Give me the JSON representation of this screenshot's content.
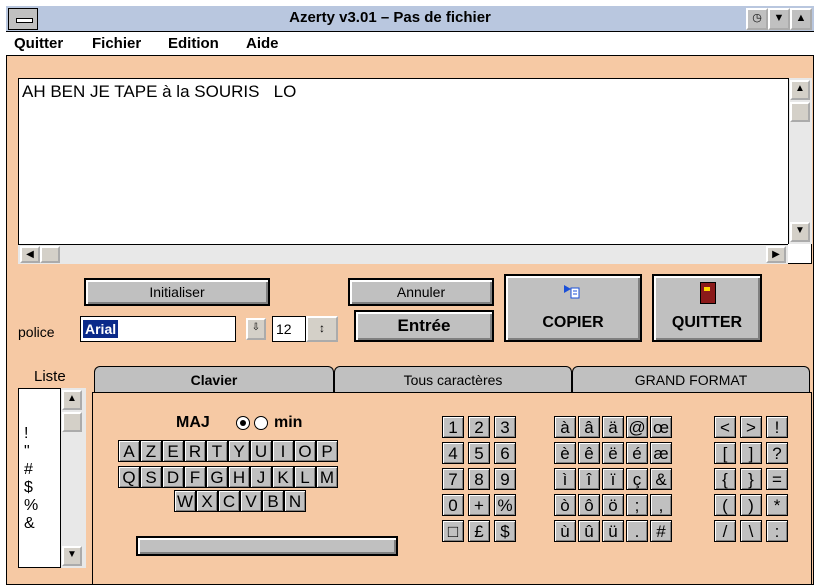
{
  "window": {
    "title": "Azerty v3.01 – Pas de fichier"
  },
  "menu": [
    "Quitter",
    "Fichier",
    "Edition",
    "Aide"
  ],
  "editor": {
    "text": "AH BEN JE TAPE à la SOURIS   LO"
  },
  "buttons": {
    "initialiser": "Initialiser",
    "annuler": "Annuler",
    "entree": "Entrée",
    "copier": "COPIER",
    "quitter": "QUITTER"
  },
  "font": {
    "label": "police",
    "value": "Arial",
    "size": "12"
  },
  "list": {
    "label": "Liste",
    "items": [
      "!",
      "\"",
      "#",
      "$",
      "%",
      "&"
    ]
  },
  "tabs": [
    "Clavier",
    "Tous caractères",
    "GRAND FORMAT"
  ],
  "case": {
    "maj": "MAJ",
    "min": "min"
  },
  "keyboard": {
    "row1": [
      "A",
      "Z",
      "E",
      "R",
      "T",
      "Y",
      "U",
      "I",
      "O",
      "P"
    ],
    "row2": [
      "Q",
      "S",
      "D",
      "F",
      "G",
      "H",
      "J",
      "K",
      "L",
      "M"
    ],
    "row3": [
      "W",
      "X",
      "C",
      "V",
      "B",
      "N"
    ]
  },
  "numpad": [
    [
      "1",
      "2",
      "3"
    ],
    [
      "4",
      "5",
      "6"
    ],
    [
      "7",
      "8",
      "9"
    ],
    [
      "0",
      "+",
      "%"
    ],
    [
      "□",
      "£",
      "$"
    ]
  ],
  "accents": [
    [
      "à",
      "â",
      "ä",
      "@",
      "œ"
    ],
    [
      "è",
      "ê",
      "ë",
      "é",
      "æ"
    ],
    [
      "ì",
      "î",
      "ï",
      "ç",
      "&"
    ],
    [
      "ò",
      "ô",
      "ö",
      ";",
      ","
    ],
    [
      "ù",
      "û",
      "ü",
      ".",
      "#"
    ]
  ],
  "symbols": [
    [
      "<",
      ">",
      "!"
    ],
    [
      "[",
      "]",
      "?"
    ],
    [
      "{",
      "}",
      "="
    ],
    [
      "(",
      ")",
      "*"
    ],
    [
      "/",
      "\\",
      ":"
    ]
  ]
}
